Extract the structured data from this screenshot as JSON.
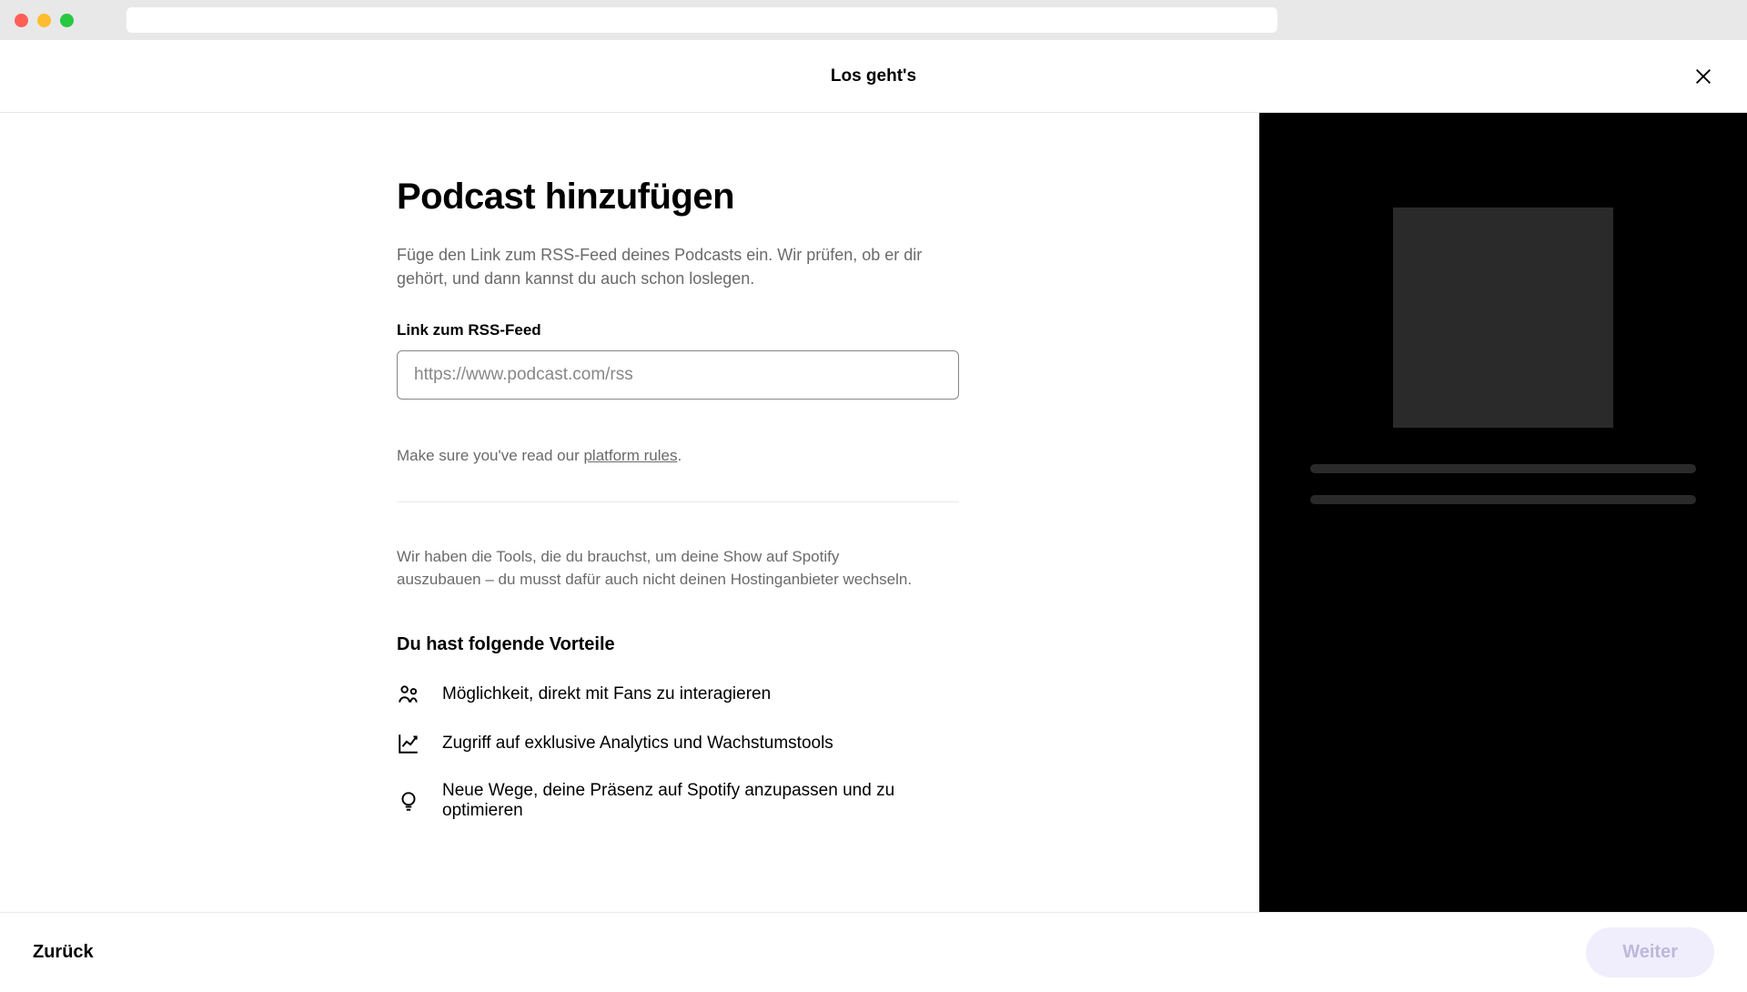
{
  "header": {
    "title": "Los geht's"
  },
  "main": {
    "title": "Podcast hinzufügen",
    "description": "Füge den Link zum RSS-Feed deines Podcasts ein. Wir prüfen, ob er dir gehört, und dann kannst du auch schon loslegen.",
    "rss_label": "Link zum RSS-Feed",
    "rss_placeholder": "https://www.podcast.com/rss",
    "rules_prefix": "Make sure you've read our ",
    "rules_link": "platform rules",
    "rules_suffix": ".",
    "tools_description": "Wir haben die Tools, die du brauchst, um deine Show auf Spotify auszubauen – du musst dafür auch nicht deinen Hostinganbieter wechseln.",
    "benefits_heading": "Du hast folgende Vorteile",
    "benefits": [
      {
        "icon": "people-icon",
        "text": "Möglichkeit, direkt mit Fans zu interagieren"
      },
      {
        "icon": "analytics-icon",
        "text": "Zugriff auf exklusive Analytics und Wachstumstools"
      },
      {
        "icon": "bulb-icon",
        "text": "Neue Wege, deine Präsenz auf Spotify anzupassen und zu optimieren"
      }
    ]
  },
  "footer": {
    "back_label": "Zurück",
    "next_label": "Weiter"
  }
}
